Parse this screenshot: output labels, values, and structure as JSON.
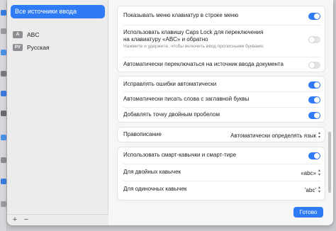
{
  "sidebar": {
    "selected_label": "Все источники ввода",
    "items": [
      {
        "badge": "A",
        "label": "ABC"
      },
      {
        "badge": "РУ",
        "label": "Русская"
      }
    ],
    "add_label": "+",
    "remove_label": "−"
  },
  "settings": {
    "show_menu": {
      "label": "Показывать меню клавиатур в строке меню",
      "on": true
    },
    "caps_lock": {
      "label_line1": "Использовать клавишу Caps Lock для переключения",
      "label_line2": "на клавиатуру «ABC» и обратно",
      "sublabel": "Нажмите и удержите, чтобы включить ввод прописными буквами.",
      "on": false
    },
    "auto_switch": {
      "label": "Автоматически переключаться на источник ввода документа",
      "on": false
    },
    "autocorrect": {
      "label": "Исправлять ошибки автоматически",
      "on": true
    },
    "capitalize": {
      "label": "Автоматически писать слова с заглавной буквы",
      "on": true
    },
    "double_space": {
      "label": "Добавлять точку двойным пробелом",
      "on": true
    },
    "spelling": {
      "label": "Правописание",
      "value": "Автоматически определять язык"
    },
    "smart_quotes": {
      "label": "Использовать смарт-кавычки и смарт-тире",
      "on": true
    },
    "double_quotes": {
      "label": "Для двойных кавычек",
      "value": "«abc»"
    },
    "single_quotes": {
      "label": "Для одиночных кавычек",
      "value": "'abc'"
    }
  },
  "done_button": "Готово",
  "colors": {
    "accent": "#2f7bf5"
  }
}
